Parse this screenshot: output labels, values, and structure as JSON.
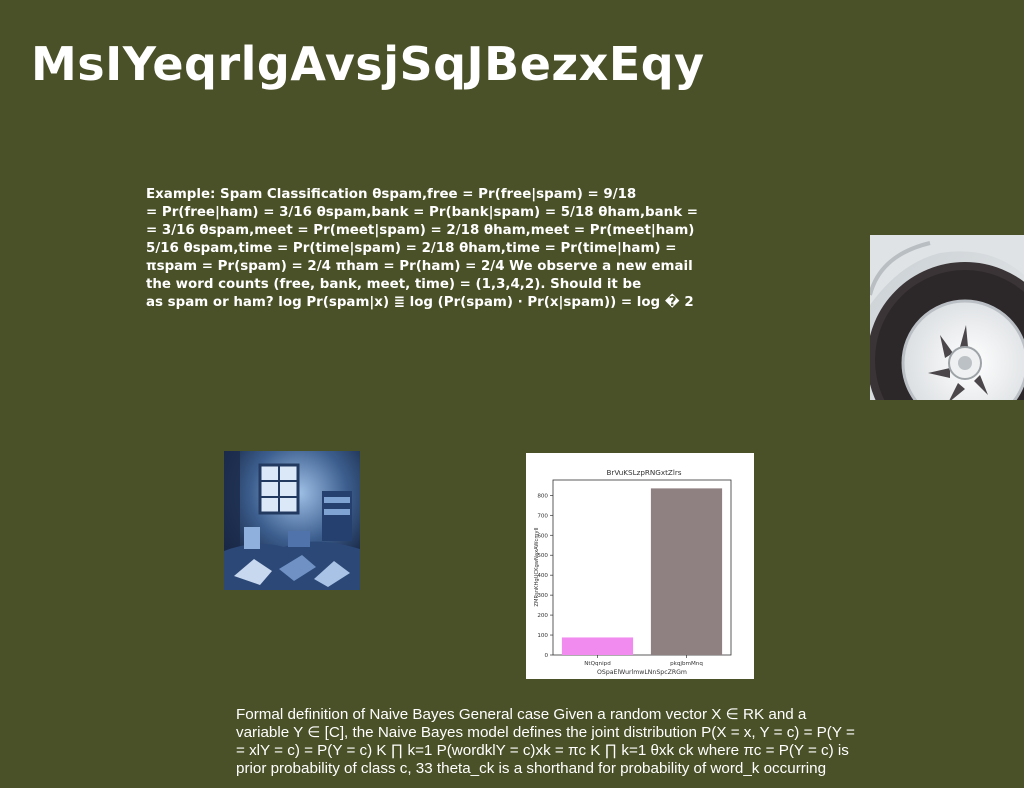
{
  "title": "MsIYeqrlgAvsjSqJBezxEqy",
  "spam_example": {
    "lines": [
      "Example: Spam Classification θspam,free = Pr(free|spam) = 9/18",
      "= Pr(free|ham) = 3/16 θspam,bank = Pr(bank|spam) = 5/18 θham,bank =",
      "= 3/16 θspam,meet = Pr(meet|spam) = 2/18 θham,meet = Pr(meet|ham)",
      "5/16 θspam,time = Pr(time|spam) = 2/18 θham,time = Pr(time|ham) =",
      "πspam = Pr(spam) = 2/4 πham = Pr(ham) = 2/4 We observe a new email",
      "the word counts (free, bank, meet, time) = (1,3,4,2). Should it be",
      "as spam or ham? log Pr(spam|x) ≣ log (Pr(spam) · Pr(x|spam)) = log � 2"
    ]
  },
  "images": {
    "tire": "car-wheel-photo",
    "room": "cluttered-room-photo"
  },
  "chart_data": {
    "type": "bar",
    "title": "BrVuKSLzpRNGxtZlrs",
    "xlabel": "OSpaElWurlmwLNnSpcZRGm",
    "ylabel": "ZMRsnKHgUCKgwNaxAWcmyII",
    "categories": [
      "NtQqnipd",
      "pkqjbmMnq"
    ],
    "values": [
      88,
      835
    ],
    "colors": [
      "#f28bef",
      "#8f8082"
    ],
    "ylim": [
      0,
      877
    ],
    "yticks": [
      "0",
      "100",
      "200",
      "300",
      "400",
      "500",
      "600",
      "700",
      "800"
    ],
    "grid": false
  },
  "naive_bayes": {
    "lines": [
      "Formal definition of Naive Bayes General case Given a random vector X ∈ RK and a",
      "variable Y ∈ [C], the Naive Bayes model defines the joint distribution P(X = x, Y = c) = P(Y =",
      "= xlY = c) = P(Y = c) K ∏ k=1 P(wordklY = c)xk = πc K ∏ k=1 θxk ck where πc = P(Y = c) is",
      "prior probability of class c, 33 theta_ck is a shorthand for probability of word_k occurring"
    ]
  }
}
